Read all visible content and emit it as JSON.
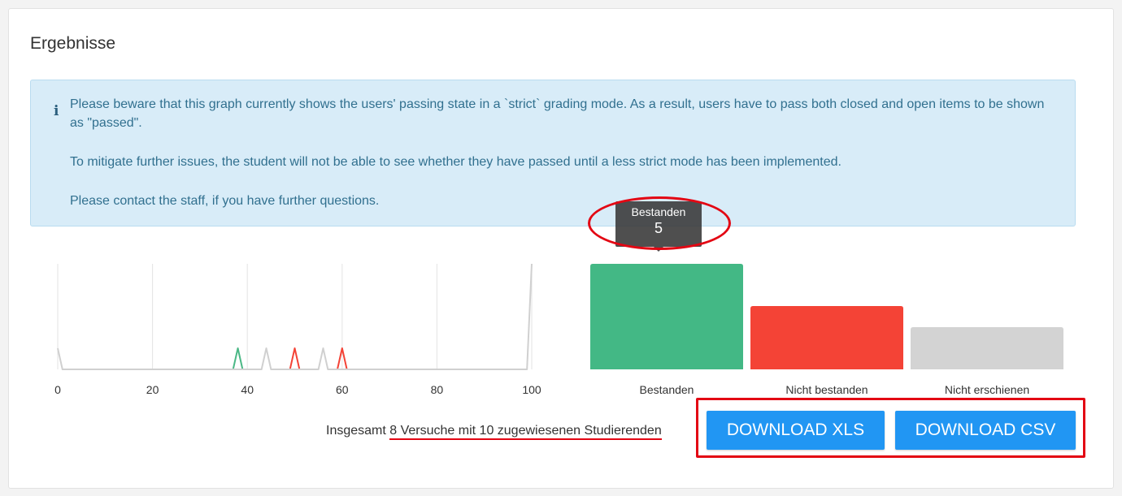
{
  "card": {
    "title": "Ergebnisse"
  },
  "alert": {
    "icon": "info-icon",
    "lines": [
      "Please beware that this graph currently shows the users' passing state in a `strict` grading mode. As a result, users have to pass both closed and open items to be shown as \"passed\".",
      "To mitigate further issues, the student will not be able to see whether they have passed until a less strict mode has been implemented.",
      "Please contact the staff, if you have further questions."
    ]
  },
  "chart_data": [
    {
      "type": "line",
      "title": "",
      "xlabel": "",
      "ylabel": "",
      "x_ticks": [
        "0",
        "20",
        "40",
        "60",
        "80",
        "100"
      ],
      "xlim": [
        0,
        100
      ],
      "ylim": [
        0,
        5
      ],
      "grid": true,
      "series": [
        {
          "color": "#4bb886",
          "points": [
            [
              37,
              0
            ],
            [
              38,
              1
            ],
            [
              39,
              0
            ]
          ]
        },
        {
          "color": "#f44336",
          "points": [
            [
              49,
              0
            ],
            [
              50,
              1
            ],
            [
              51,
              0
            ]
          ]
        },
        {
          "color": "#f44336",
          "points": [
            [
              59,
              0
            ],
            [
              60,
              1
            ],
            [
              61,
              0
            ]
          ]
        },
        {
          "color": "#d0d0d0",
          "points": [
            [
              0,
              1
            ],
            [
              1,
              0
            ],
            [
              43,
              0
            ],
            [
              44,
              1
            ],
            [
              45,
              0
            ],
            [
              55,
              0
            ],
            [
              56,
              1
            ],
            [
              57,
              0
            ],
            [
              99,
              0
            ],
            [
              100,
              5
            ]
          ]
        }
      ]
    },
    {
      "type": "bar",
      "title": "",
      "categories": [
        "Bestanden",
        "Nicht bestanden",
        "Nicht erschienen"
      ],
      "values": [
        5,
        3,
        2
      ],
      "colors": [
        "#43b885",
        "#f44336",
        "#d3d3d3"
      ],
      "ylim": [
        0,
        5
      ],
      "grid": false
    }
  ],
  "tooltip": {
    "label": "Bestanden",
    "value": "5"
  },
  "summary": {
    "prefix": "Insgesamt ",
    "highlight": "8 Versuche mit 10 zugewiesenen Studierenden"
  },
  "buttons": {
    "xls": "Download XLS",
    "csv": "Download CSV"
  },
  "colors": {
    "primary": "#2196f3",
    "annotation": "#e30613",
    "alert_bg": "#d8ecf8",
    "alert_text": "#31708f"
  }
}
